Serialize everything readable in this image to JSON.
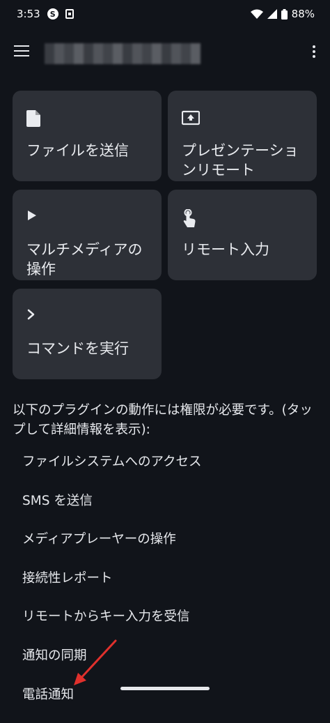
{
  "status": {
    "time": "3:53",
    "battery": "88%",
    "badge_letter": "S"
  },
  "colors": {
    "background": "#11141a",
    "card": "#2d3037",
    "text": "#e6e8ec",
    "annotation": "#e0302c"
  },
  "cards": [
    {
      "label": "ファイルを送信",
      "icon": "file-icon"
    },
    {
      "label": "プレゼンテーションリモート",
      "icon": "presentation-icon"
    },
    {
      "label": "マルチメディアの操作",
      "icon": "play-icon"
    },
    {
      "label": "リモート入力",
      "icon": "touch-icon"
    },
    {
      "label": "コマンドを実行",
      "icon": "chevron-right-icon"
    }
  ],
  "permissions": {
    "heading": "以下のプラグインの動作には権限が必要です。(タップして詳細情報を表示):",
    "items": [
      "ファイルシステムへのアクセス",
      "SMS を送信",
      "メディアプレーヤーの操作",
      "接続性レポート",
      "リモートからキー入力を受信",
      "通知の同期",
      "電話通知"
    ]
  }
}
